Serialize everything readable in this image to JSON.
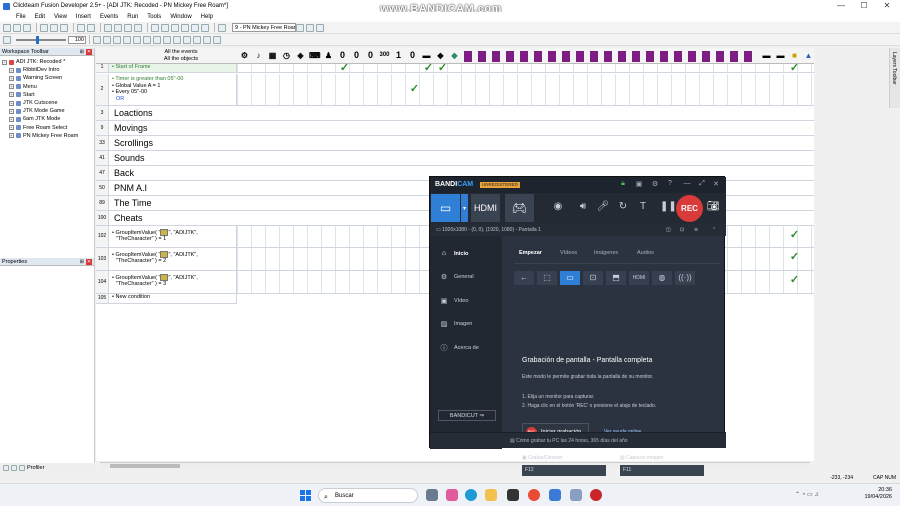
{
  "window": {
    "title": "Clickteam Fusion Developer 2.5+ - [ADI JTK: Recoded - PN Mickey Free Roam*]",
    "minimize": "—",
    "maximize": "☐",
    "close": "✕"
  },
  "menu": [
    "File",
    "Edit",
    "View",
    "Insert",
    "Events",
    "Run",
    "Tools",
    "Window",
    "Help"
  ],
  "toolbar": {
    "frame_select": "9 - PN Mickey Free Roam",
    "zoom_value": "100"
  },
  "watermark": "www.BANDICAM.com",
  "workspace": {
    "title": "Workspace Toolbar",
    "root": "ADI JTK: Recoded *",
    "items": [
      "RibbitDev Intro",
      "Warning Screen",
      "Menu",
      "Start",
      "JTK Cutscene",
      "JTK Mode Game",
      "6am JTK Mode",
      "Free Roam Select",
      "PN Mickey Free Roam"
    ]
  },
  "properties": {
    "title": "Properties"
  },
  "bottom_tab": {
    "label": "Profiler"
  },
  "editor": {
    "all_events": "All the events",
    "all_objects": "All the objects",
    "counter_labels": [
      "0",
      "0",
      "0",
      "300",
      "1",
      "0"
    ],
    "events": [
      {
        "num": "1",
        "lines": [
          "Start of Frame"
        ]
      },
      {
        "num": "2",
        "lines": [
          "Timer is greater than 05\"-00",
          "Global Value A = 1",
          "Every 05\"-00",
          "OR"
        ]
      }
    ],
    "groups": [
      {
        "num": "3",
        "title": "Loactions"
      },
      {
        "num": "9",
        "title": "Movings"
      },
      {
        "num": "33",
        "title": "Scrollings"
      },
      {
        "num": "41",
        "title": "Sounds"
      },
      {
        "num": "47",
        "title": "Back"
      },
      {
        "num": "50",
        "title": "PNM A.I"
      },
      {
        "num": "89",
        "title": "The Time"
      },
      {
        "num": "100",
        "title": "Cheats"
      }
    ],
    "value_events": [
      {
        "num": "102",
        "line1": "GroupItemValue( \"",
        "line1b": "\", \"ADIJTK\",",
        "line2": "\"TheCharacter\" ) = 1"
      },
      {
        "num": "103",
        "line1": "GroupItemValue( \"",
        "line1b": "\", \"ADIJTK\",",
        "line2": "\"TheCharacter\" ) = 2"
      },
      {
        "num": "104",
        "line1": "GroupItemValue( \"",
        "line1b": "\", \"ADIJTK\",",
        "line2": "\"TheCharacter\" ) = 3"
      }
    ],
    "new_condition": {
      "num": "105",
      "label": "New condition"
    }
  },
  "layers_label": "Layers Toolbar",
  "status": {
    "coords": "-233, -234",
    "mode": "CAP NUM"
  },
  "bandicam": {
    "logo_a": "BANDI",
    "logo_b": "CAM",
    "unregistered": "UNREGISTERED",
    "rec": "REC",
    "hdmi": "HDMI",
    "resolution_info": "1920x1080 - (0, 0), (1920, 1080) - Pantalla 1",
    "nav": [
      "Inicio",
      "General",
      "Vídeo",
      "Imagen",
      "Acerca de"
    ],
    "bandicut": "BANDICUT ⇒",
    "tabs": [
      "Empezar",
      "Vídeos",
      "Imágenes",
      "Audios"
    ],
    "subtitle": "Grabación de pantalla - Pantalla completa",
    "description": "Este modo le permite grabar toda la pantalla de su monitor.",
    "step1": "1. Elija un monitor para capturar.",
    "step2": "2. Haga clic en el botón 'REC' o presione el atajo de teclado.",
    "start_rec": "Iniciar grabación",
    "start_rec_dot": "REC",
    "help_link": "Ver ayuda online",
    "hotkey1_label": "Grabar/Detener",
    "hotkey1": "F12",
    "hotkey2_label": "Capturar imagen",
    "hotkey2": "F11",
    "footer": "Cómo grabar tu PC las 24 horas, 365 días del año"
  },
  "taskbar": {
    "search_placeholder": "Buscar",
    "time": "20:36",
    "date": "19/04/2026"
  },
  "colors": {
    "accent": "#2f7fd6",
    "rec": "#d93a3a",
    "check": "#2e8b2e",
    "object_purple": "#7d1d82"
  }
}
